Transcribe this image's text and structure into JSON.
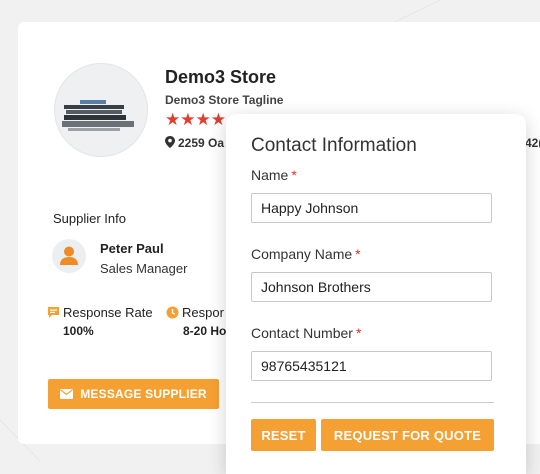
{
  "store": {
    "name": "Demo3 Store",
    "tagline": "Demo3 Store Tagline",
    "rating_stars": "★★★★",
    "address": "2259 Oa",
    "address_suffix": "42("
  },
  "supplier": {
    "section_title": "Supplier Info",
    "name": "Peter Paul",
    "role": "Sales Manager"
  },
  "stats": {
    "response_rate_label": "Response Rate",
    "response_rate_value": "100%",
    "response_time_label": "Respor",
    "response_time_value": "8-20 Ho"
  },
  "actions": {
    "message_supplier": "MESSAGE SUPPLIER"
  },
  "contact_form": {
    "title": "Contact Information",
    "name_label": "Name",
    "name_value": "Happy Johnson",
    "company_label": "Company Name",
    "company_value": "Johnson Brothers",
    "phone_label": "Contact Number",
    "phone_value": "98765435121",
    "required_marker": "*",
    "reset_label": "RESET",
    "submit_label": "REQUEST FOR QUOTE"
  },
  "colors": {
    "accent": "#f5a032",
    "required": "#d9302c",
    "star": "#e33d2f"
  }
}
